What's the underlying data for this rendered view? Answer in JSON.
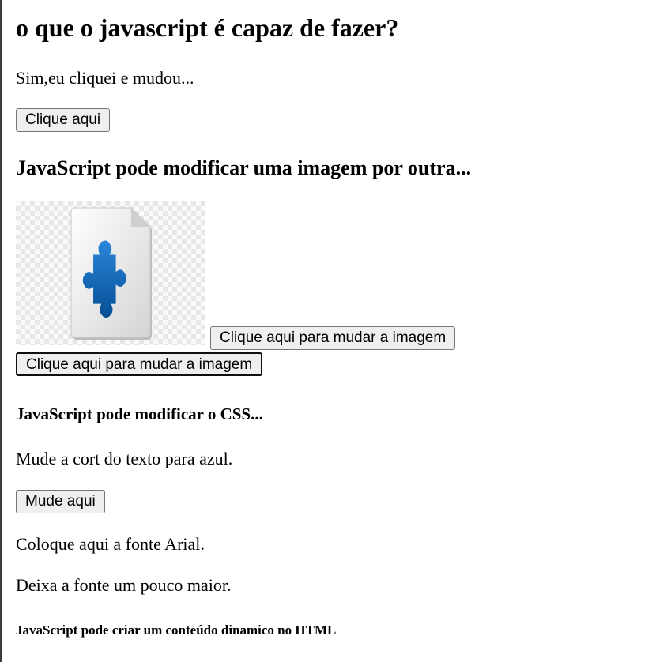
{
  "heading": "o que o javascript é capaz de fazer?",
  "demo_text": "Sim,eu cliquei e mudou...",
  "click_button": "Clique aqui",
  "image_section_title": "JavaScript pode modificar uma imagem por outra...",
  "image_icon": "puzzle-file-icon",
  "image_button_inline": "Clique aqui para mudar a imagem",
  "image_button_below": "Clique aqui para mudar a imagem",
  "css_section_title": "JavaScript pode modificar o CSS...",
  "css_text": "Mude a cort do texto para azul.",
  "css_button": "Mude aqui",
  "font_text": "Coloque aqui a fonte Arial.",
  "size_text": "Deixa a fonte um pouco maior.",
  "dynamic_section_title": "JavaScript pode criar um conteúdo dinamico no HTML",
  "colors": {
    "puzzle_blue": "#0a63b0",
    "button_bg": "#efefef",
    "button_border": "#767676"
  }
}
